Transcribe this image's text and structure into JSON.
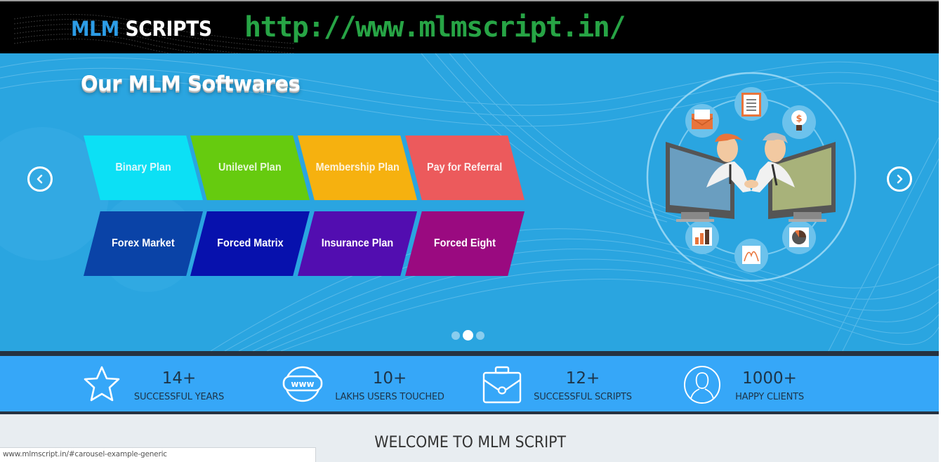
{
  "header": {
    "logo_part1": "MLM",
    "logo_part2": " SCRIPTS",
    "url_banner": "http://www.mlmscript.in/"
  },
  "carousel": {
    "title": "Our MLM Softwares",
    "tiles_row1": [
      {
        "label": "Binary Plan",
        "color": "#0ce0f5"
      },
      {
        "label": "Unilevel Plan",
        "color": "#66cb0f"
      },
      {
        "label": "Membership Plan",
        "color": "#f6b10f"
      },
      {
        "label": "Pay for Referral",
        "color": "#ec5a5c"
      }
    ],
    "tiles_row2": [
      {
        "label": "Forex Market",
        "color": "#0a43a7"
      },
      {
        "label": "Forced Matrix",
        "color": "#0711ad"
      },
      {
        "label": "Insurance Plan",
        "color": "#520db0"
      },
      {
        "label": "Forced Eight",
        "color": "#9a0a80"
      }
    ],
    "prev_icon": "chevron-left-circle-icon",
    "next_icon": "chevron-right-circle-icon",
    "slides_total": 3,
    "active_slide": 2,
    "illustration": "handshake-between-monitors-illustration"
  },
  "stats": [
    {
      "icon": "star-icon",
      "number": "14+",
      "label": "SUCCESSFUL YEARS"
    },
    {
      "icon": "www-globe-icon",
      "number": "10+",
      "label": "LAKHS USERS TOUCHED"
    },
    {
      "icon": "briefcase-icon",
      "number": "12+",
      "label": "SUCCESSFUL SCRIPTS"
    },
    {
      "icon": "user-circle-icon",
      "number": "1000+",
      "label": "HAPPY CLIENTS"
    }
  ],
  "welcome": {
    "heading": "WELCOME TO MLM SCRIPT"
  },
  "status_bar": {
    "url": "www.mlmscript.in/#carousel-example-generic"
  },
  "colors": {
    "carousel_bg": "#2aa5e0",
    "stats_bg": "#36a7f8",
    "divider": "#253241",
    "url_green": "#27a445",
    "logo_blue": "#2c9ce6"
  }
}
